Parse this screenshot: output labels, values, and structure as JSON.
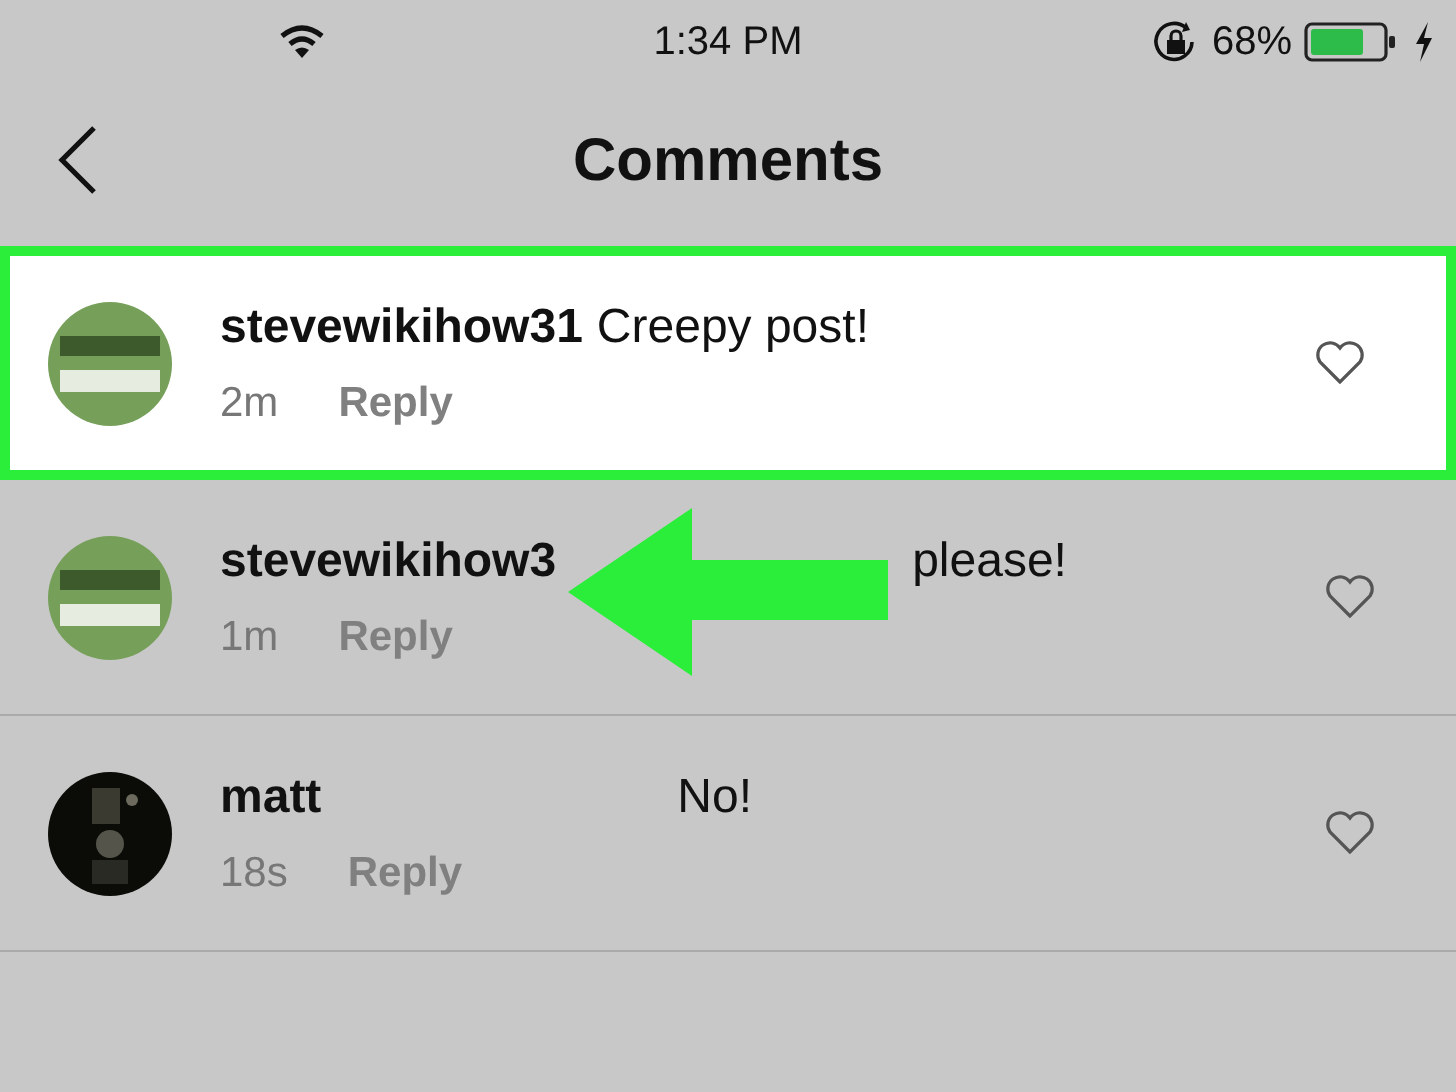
{
  "status_bar": {
    "time": "1:34 PM",
    "battery_percent": "68%"
  },
  "nav": {
    "title": "Comments"
  },
  "comments": [
    {
      "username": "stevewikihow31",
      "text": "Creepy post!",
      "time": "2m",
      "reply": "Reply",
      "highlighted": true
    },
    {
      "username": "stevewikihow3",
      "text": "please!",
      "time": "1m",
      "reply": "Reply",
      "highlighted": false
    },
    {
      "username": "matt",
      "text": "No!",
      "time": "18s",
      "reply": "Reply",
      "highlighted": false
    }
  ]
}
